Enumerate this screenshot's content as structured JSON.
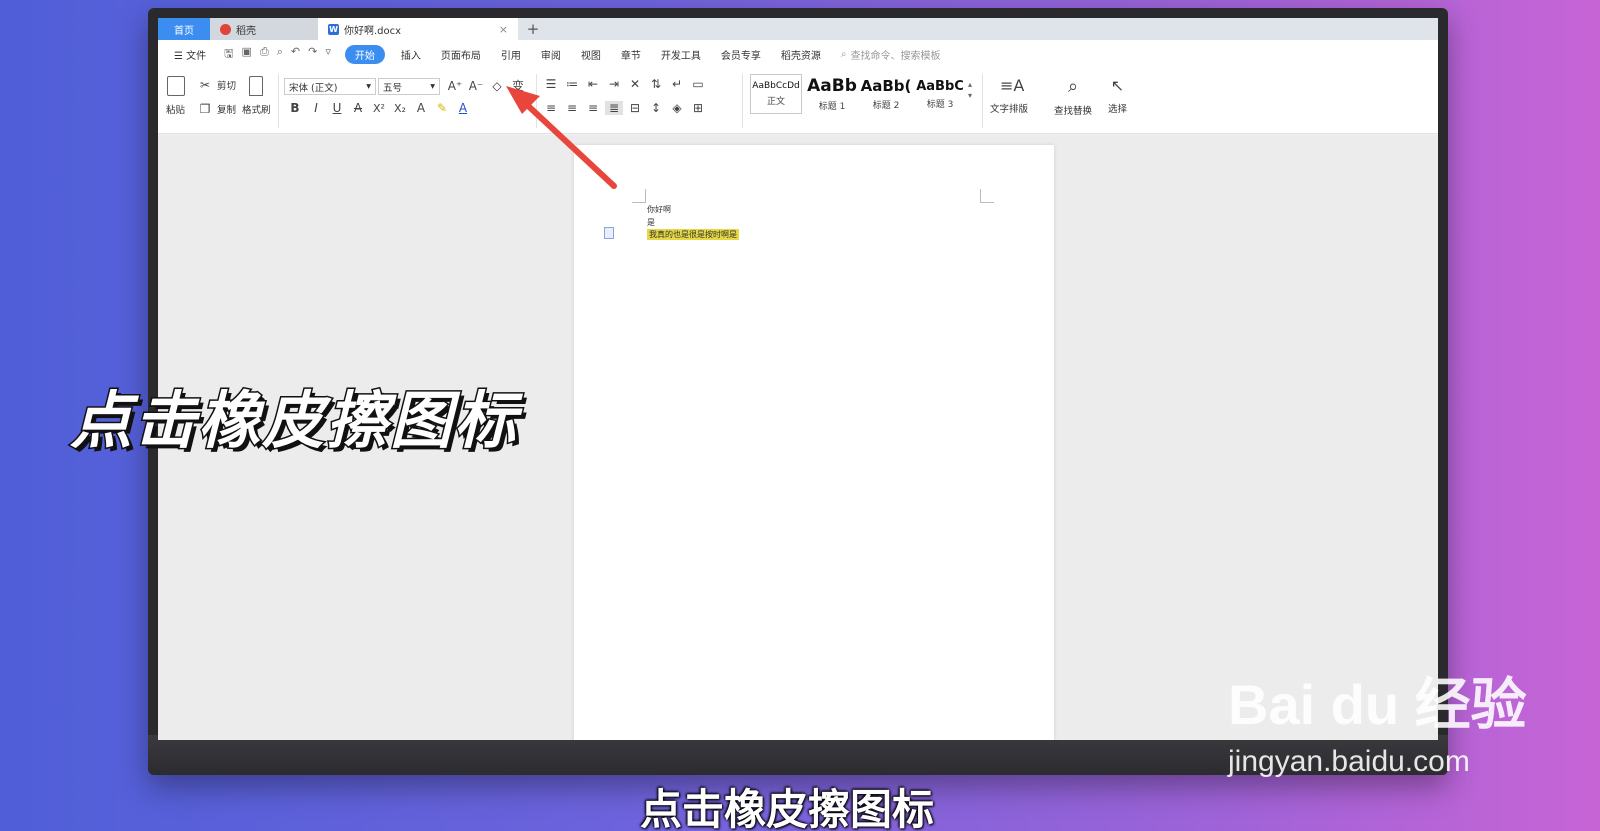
{
  "tabs": {
    "home": "首页",
    "daoke": "稻壳",
    "doc": "你好啊.docx",
    "close": "×",
    "plus": "+"
  },
  "menubar": {
    "file": "文件",
    "items": [
      "开始",
      "插入",
      "页面布局",
      "引用",
      "审阅",
      "视图",
      "章节",
      "开发工具",
      "会员专享",
      "稻壳资源"
    ],
    "search_placeholder": "查找命令、搜索模板"
  },
  "ribbon": {
    "paste": "粘贴",
    "cut": "剪切",
    "copy": "复制",
    "format_painter": "格式刷",
    "font_name": "宋体 (正文)",
    "font_size": "五号",
    "styles": [
      {
        "sample": "AaBbCcDd",
        "label": "正文"
      },
      {
        "sample": "AaBb",
        "label": "标题 1"
      },
      {
        "sample": "AaBb(",
        "label": "标题 2"
      },
      {
        "sample": "AaBbC",
        "label": "标题 3"
      }
    ],
    "text_layout": "文字排版",
    "find_replace": "查找替换",
    "select": "选择"
  },
  "document": {
    "lines": [
      "你好啊",
      "是",
      "我真的也是很是按时啊是"
    ]
  },
  "overlay": {
    "caption": "点击橡皮擦图标",
    "subtitle": "点击橡皮擦图标"
  },
  "watermark": {
    "logo": "Bai du 经验",
    "url": "jingyan.baidu.com"
  },
  "colors": {
    "accent": "#3b8ef0",
    "highlight": "#e6d843",
    "arrow": "#e8463c"
  }
}
